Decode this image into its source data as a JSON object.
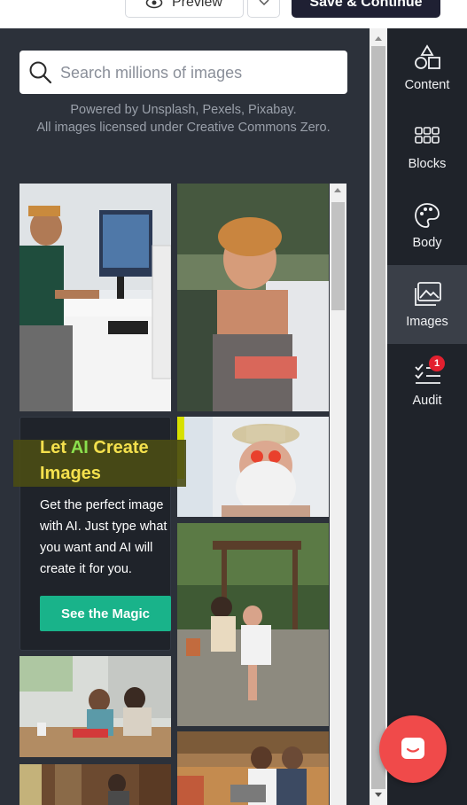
{
  "toolbar": {
    "preview_label": "Preview",
    "save_label": "Save & Continue"
  },
  "search": {
    "placeholder": "Search millions of images"
  },
  "powered_by": {
    "line1": "Powered by Unsplash, Pexels, Pixabay.",
    "line2": "All images licensed under Creative Commons Zero."
  },
  "promo": {
    "title_part1": "Let",
    "title_ai": "AI",
    "title_part2": "Create Images",
    "body": "Get the perfect image with AI. Just type what you want and AI will create it for you.",
    "button": "See the Magic"
  },
  "sidebar": {
    "items": [
      {
        "label": "Content",
        "icon": "shapes-icon"
      },
      {
        "label": "Blocks",
        "icon": "blocks-grid-icon"
      },
      {
        "label": "Body",
        "icon": "palette-icon"
      },
      {
        "label": "Images",
        "icon": "images-icon",
        "active": true
      },
      {
        "label": "Audit",
        "icon": "checklist-icon",
        "badge": "1"
      }
    ]
  },
  "colors": {
    "panel_bg": "#2c313a",
    "sidebar_bg": "#1f232a",
    "accent_green": "#19b38a",
    "badge_red": "#e3202f",
    "promo_title": "#f4e04d",
    "chat_button": "#f04a4a"
  }
}
